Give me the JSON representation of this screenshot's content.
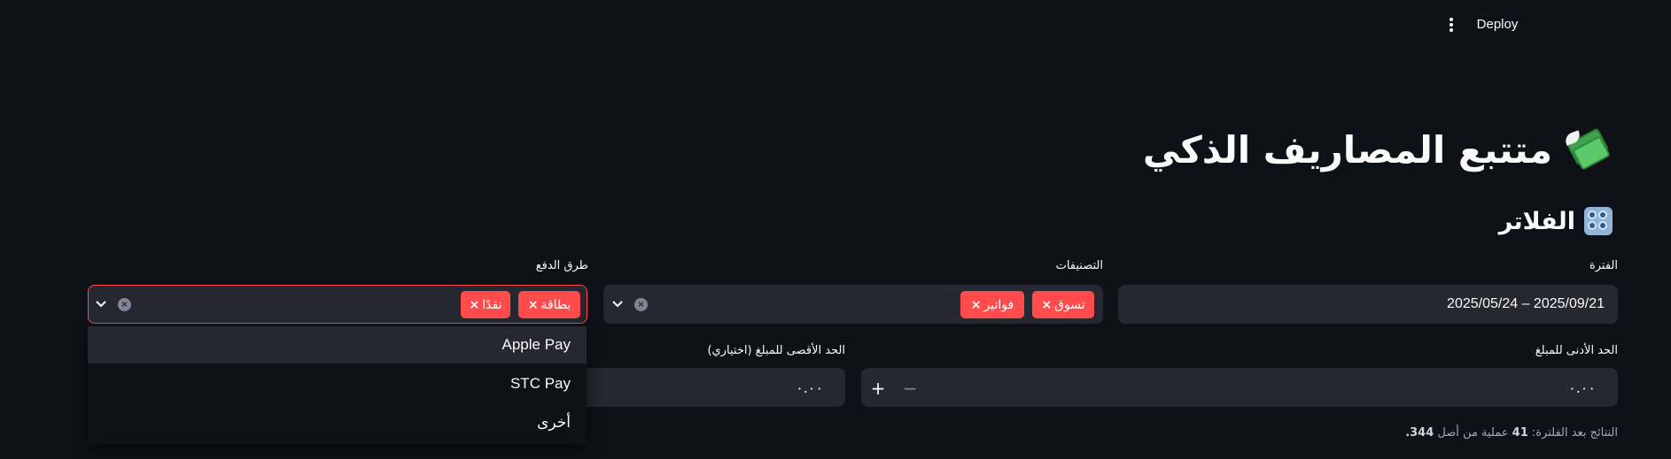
{
  "toolbar": {
    "menu_icon": "kebab-menu-icon",
    "deploy_label": "Deploy"
  },
  "title": {
    "text": "متتبع المصاريف الذكي",
    "icon": "flying-money-icon"
  },
  "filters": {
    "section_title": "الفلاتر",
    "section_icon": "control-knobs-icon",
    "period": {
      "label": "الفترة",
      "value": "2025/05/24 – 2025/09/21"
    },
    "categories": {
      "label": "التصنيفات",
      "chips": [
        "تسوق",
        "فواتير"
      ]
    },
    "payment_methods": {
      "label": "طرق الدفع",
      "chips": [
        "بطاقة",
        "نقدًا"
      ],
      "dropdown_options": [
        "Apple Pay",
        "STC Pay",
        "أخرى"
      ]
    },
    "min_amount": {
      "label": "الحد الأدنى للمبلغ",
      "value": "٠.٠٠",
      "plus": "+",
      "minus": "−"
    },
    "max_amount": {
      "label": "الحد الأقصى للمبلغ (اختياري)",
      "value": "٠.٠٠"
    }
  },
  "results": {
    "prefix": "النتائج بعد الفلترة:",
    "filtered_count": "41",
    "middle": "عملية من أصل",
    "total_count": "344."
  },
  "colors": {
    "background": "#0e1117",
    "input_bg": "#262730",
    "accent": "#ff4b4b"
  }
}
